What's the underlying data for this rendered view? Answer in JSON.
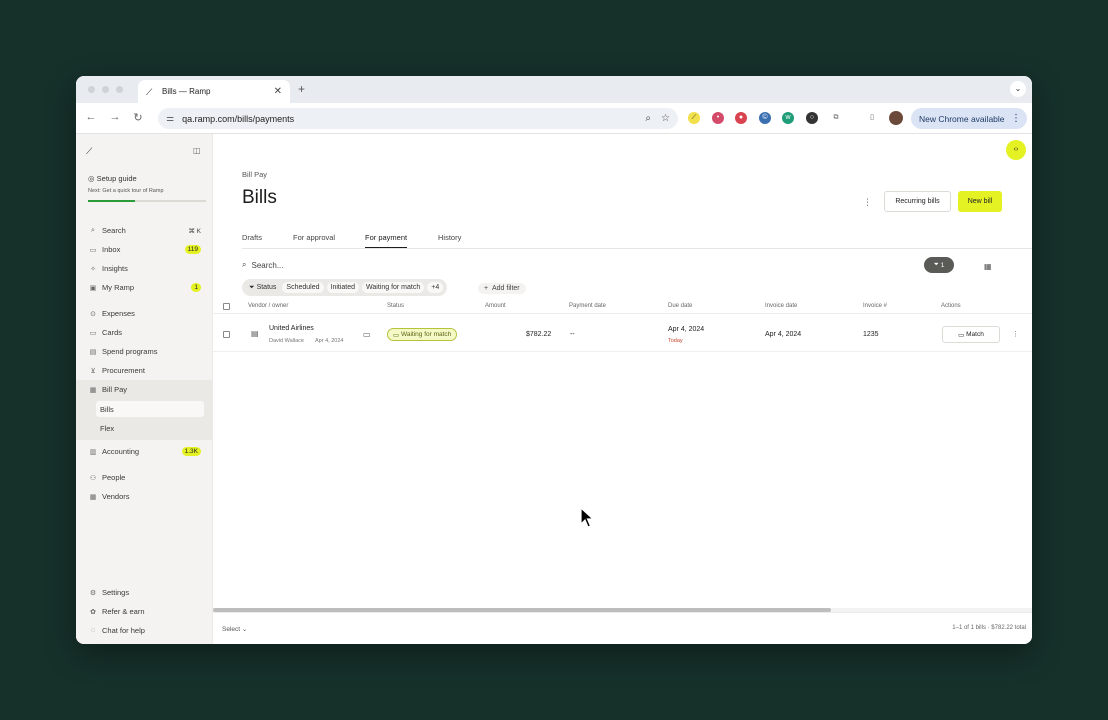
{
  "browser": {
    "tab_title": "Bills — Ramp",
    "tab_close": "✕",
    "new_tab": "+",
    "url": "qa.ramp.com/bills/payments",
    "update_label": "New Chrome available"
  },
  "sidebar": {
    "setup_title": "Setup guide",
    "setup_subtitle": "Next: Get a quick tour of Ramp",
    "setup_progress": 0.4,
    "search_label": "Search",
    "search_shortcut": "⌘ K",
    "inbox_label": "Inbox",
    "inbox_count": "119",
    "insights_label": "Insights",
    "myramp_label": "My Ramp",
    "myramp_count": "1",
    "expenses_label": "Expenses",
    "cards_label": "Cards",
    "spend_programs_label": "Spend programs",
    "procurement_label": "Procurement",
    "billpay_label": "Bill Pay",
    "bills_label": "Bills",
    "flex_label": "Flex",
    "accounting_label": "Accounting",
    "accounting_count": "1.3K",
    "people_label": "People",
    "vendors_label": "Vendors",
    "settings_label": "Settings",
    "refer_label": "Refer & earn",
    "chat_label": "Chat for help"
  },
  "header": {
    "eyebrow": "Bill Pay",
    "title": "Bills",
    "recurring_label": "Recurring bills",
    "new_bill_label": "New bill",
    "dev_toggle": "‹›"
  },
  "tabs": [
    "Drafts",
    "For approval",
    "For payment",
    "History"
  ],
  "toolbar": {
    "search_placeholder": "Search...",
    "filter_count": "1"
  },
  "filters": {
    "status_label": "Status",
    "chips": [
      "Scheduled",
      "Initiated",
      "Waiting for match",
      "+4"
    ],
    "add_filter_label": "Add filter"
  },
  "table": {
    "columns": [
      "Vendor / owner",
      "Status",
      "Amount",
      "Payment date",
      "Due date",
      "Invoice date",
      "Invoice #",
      "Actions"
    ],
    "rows": [
      {
        "vendor": "United Airlines",
        "owner": "David Wallace",
        "owner_date": "Apr 4, 2024",
        "status": "Waiting for match",
        "amount": "$782.22",
        "payment_date": "--",
        "due_date": "Apr 4, 2024",
        "due_note": "Today",
        "invoice_date": "Apr 4, 2024",
        "invoice_number": "1235",
        "action": "Match"
      }
    ]
  },
  "footer": {
    "select_label": "Select",
    "summary": "1–1 of 1 bills  ·  $782.22 total"
  },
  "colors": {
    "accent": "#e4f223",
    "backdrop": "#16302a",
    "overdue": "#c2462a"
  }
}
